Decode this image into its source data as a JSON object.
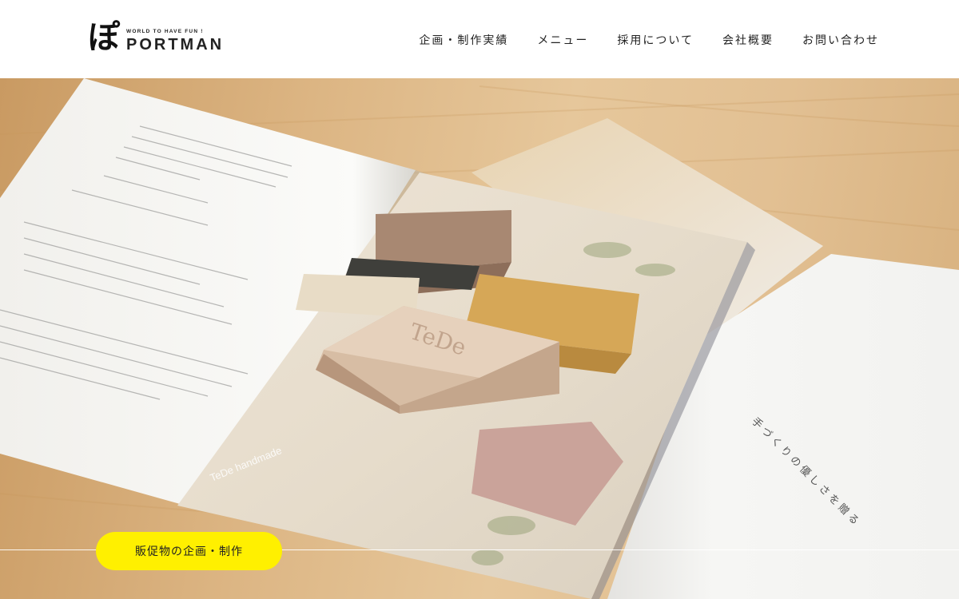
{
  "header": {
    "logo": {
      "mark": "ぽ",
      "tagline": "WORLD TO HAVE FUN !",
      "wordmark": "PORTMAN"
    },
    "nav": [
      {
        "label": "企画・制作実績"
      },
      {
        "label": "メニュー"
      },
      {
        "label": "採用について"
      },
      {
        "label": "会社概要"
      },
      {
        "label": "お問い合わせ"
      }
    ]
  },
  "hero": {
    "image_text": {
      "soap_brand": "TeDe",
      "page_caption": "TeDe handmade",
      "right_page_copy": "手づくりの優しさを贈る"
    },
    "cta_label": "販促物の企画・制作"
  },
  "colors": {
    "accent_yellow": "#fff000",
    "text": "#222222",
    "background": "#ffffff"
  }
}
